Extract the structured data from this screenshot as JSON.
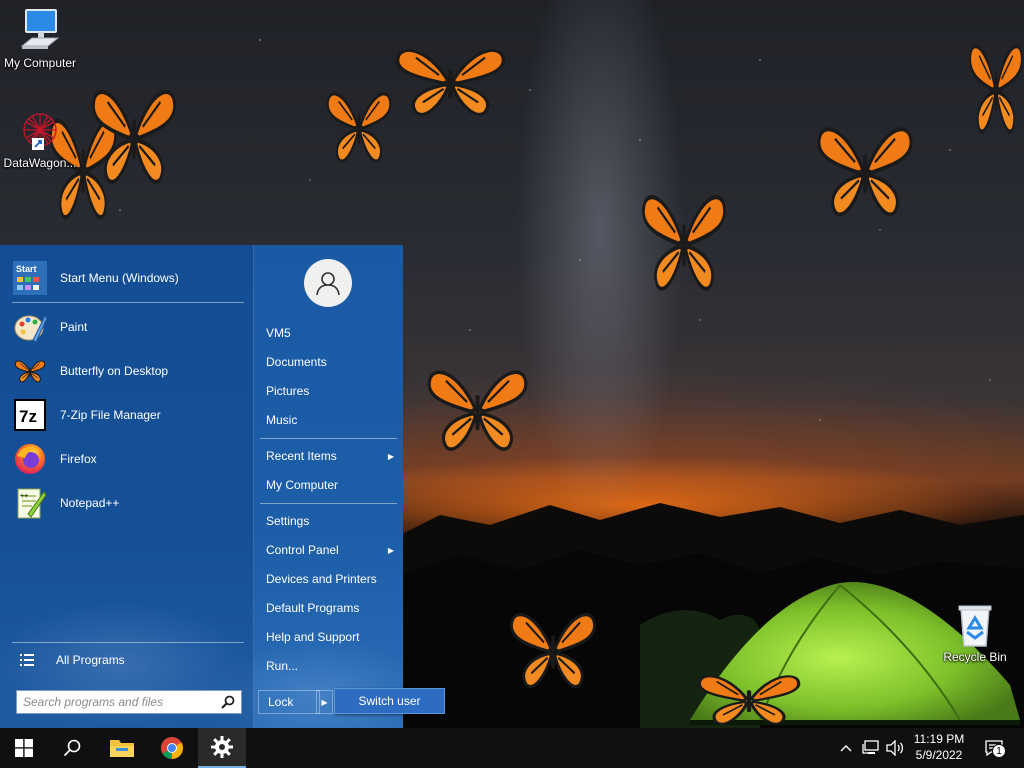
{
  "desktop": {
    "icons": [
      {
        "label": "My Computer",
        "icon": "computer-icon"
      },
      {
        "label": "DataWagon...",
        "icon": "datawagon-icon"
      },
      {
        "label": "Recycle Bin",
        "icon": "recycle-bin-icon"
      }
    ]
  },
  "start_menu": {
    "programs": [
      {
        "label": "Start Menu (Windows)",
        "icon": "start-menu-app-icon"
      },
      {
        "label": "Paint",
        "icon": "paint-icon"
      },
      {
        "label": "Butterfly on Desktop",
        "icon": "butterfly-icon"
      },
      {
        "label": "7-Zip File Manager",
        "icon": "7zip-icon"
      },
      {
        "label": "Firefox",
        "icon": "firefox-icon"
      },
      {
        "label": "Notepad++",
        "icon": "notepadpp-icon"
      }
    ],
    "start_tile_text": "Start",
    "zip_tile_text": "7z",
    "all_programs": "All Programs",
    "search_placeholder": "Search programs and files",
    "places": [
      {
        "label": "VM5"
      },
      {
        "label": "Documents"
      },
      {
        "label": "Pictures"
      },
      {
        "label": "Music"
      },
      {
        "label": "Recent Items",
        "submenu": true
      },
      {
        "label": "My Computer"
      },
      {
        "label": "Settings"
      },
      {
        "label": "Control Panel",
        "submenu": true
      },
      {
        "label": "Devices and Printers"
      },
      {
        "label": "Default Programs"
      },
      {
        "label": "Help and Support"
      },
      {
        "label": "Run..."
      }
    ],
    "submenu_arrow": "▶",
    "lock": "Lock",
    "switch_user": "Switch user"
  },
  "taskbar": {
    "buttons": [
      "windows-start-icon",
      "search-icon",
      "file-explorer-icon",
      "chrome-icon",
      "settings-icon"
    ],
    "clock_time": "11:19 PM",
    "clock_date": "5/9/2022",
    "notification_count": "1",
    "accent": "#78aee8"
  },
  "colors": {
    "start_menu_blue": "#1d5ea8",
    "butterfly_orange": "#f07a14"
  }
}
